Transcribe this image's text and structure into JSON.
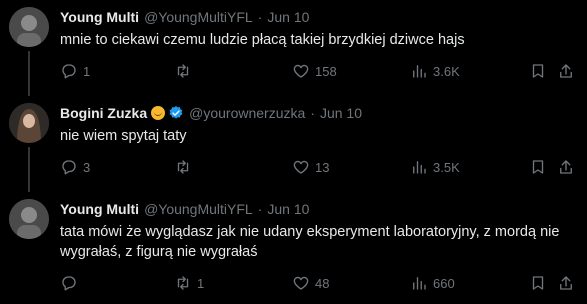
{
  "tweets": [
    {
      "name": "Young Multi",
      "handle": "@YoungMultiYFL",
      "separator": "·",
      "time": "Jun 10",
      "text": "mnie to ciekawi czemu ludzie płacą takiej brzydkiej dziwce hajs",
      "replies": "1",
      "retweets": "",
      "likes": "158",
      "views": "3.6K"
    },
    {
      "name": "Bogini Zuzka",
      "handle": "@yourownerzuzka",
      "separator": "·",
      "time": "Jun 10",
      "text": "nie wiem spytaj taty",
      "replies": "3",
      "retweets": "",
      "likes": "13",
      "views": "3.5K"
    },
    {
      "name": "Young Multi",
      "handle": "@YoungMultiYFL",
      "separator": "·",
      "time": "Jun 10",
      "text": "tata mówi że wyglądasz jak nie udany eksperyment laboratoryjny, z mordą nie wygrałaś, z figurą nie wygrałaś",
      "replies": "",
      "retweets": "1",
      "likes": "48",
      "views": "660"
    }
  ],
  "colors": {
    "background": "#000000",
    "primary_text": "#e7e9ea",
    "secondary_text": "#71767b",
    "verified": "#1d9bf0",
    "divider": "#333639"
  }
}
